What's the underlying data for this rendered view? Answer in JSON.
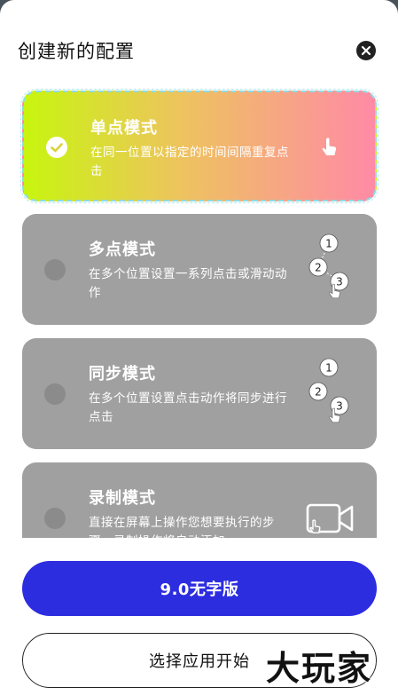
{
  "header": {
    "title": "创建新的配置"
  },
  "modes": [
    {
      "title": "单点模式",
      "desc": "在同一位置以指定的时间间隔重复点击",
      "selected": true
    },
    {
      "title": "多点模式",
      "desc": "在多个位置设置一系列点击或滑动动作",
      "selected": false
    },
    {
      "title": "同步模式",
      "desc": "在多个位置设置点击动作将同步进行点击",
      "selected": false
    },
    {
      "title": "录制模式",
      "desc": "直接在屏幕上操作您想要执行的步骤，录制操作将自动添加",
      "selected": false
    }
  ],
  "icon_labels": {
    "one": "1",
    "two": "2",
    "three": "3"
  },
  "buttons": {
    "vip": "9.0无字版",
    "start": "选择应用开始"
  },
  "watermark": "大玩家",
  "colors": {
    "accent": "#2d2de0",
    "card_gray": "#a0a0a0",
    "gradient_start": "#c8f50f",
    "gradient_end": "#ff8aa6"
  },
  "icons": {
    "close": "close-icon",
    "check": "check-circle-icon",
    "tap": "tap-hand-icon",
    "multi": "multi-tap-icon",
    "record": "record-video-icon"
  }
}
